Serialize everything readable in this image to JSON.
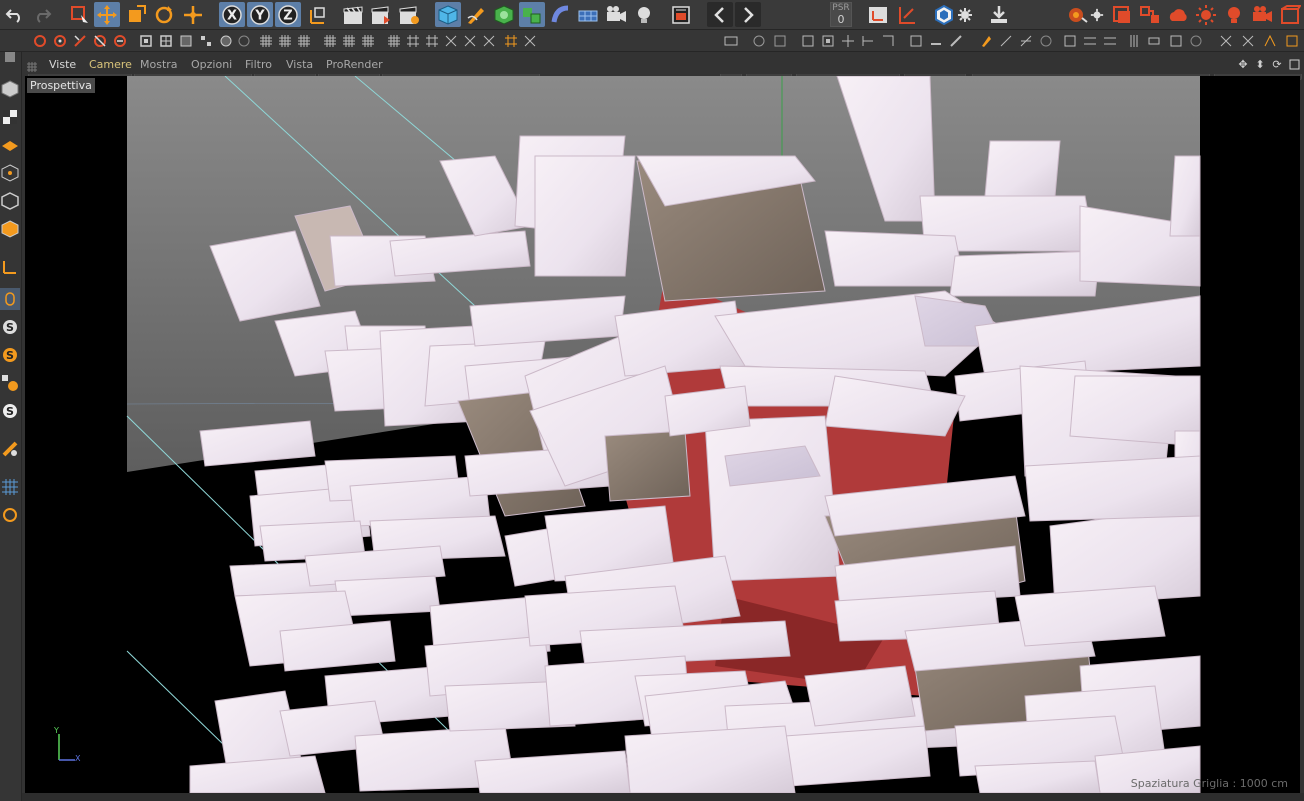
{
  "menubar": {
    "items": [
      "Viste",
      "Camere",
      "Mostra",
      "Opzioni",
      "Filtro",
      "Vista",
      "ProRender"
    ]
  },
  "viewport": {
    "label": "Prospettiva",
    "grid_info": "Spaziatura Griglia : 1000 cm",
    "axis_y": "Y",
    "axis_x": "X"
  },
  "toolbar": {
    "psr_label": "PSR",
    "psr_value": "0"
  },
  "colors": {
    "accent_orange": "#f39a1e",
    "select_blue": "#5d7fa8",
    "menu_active": "#d8c37a"
  }
}
